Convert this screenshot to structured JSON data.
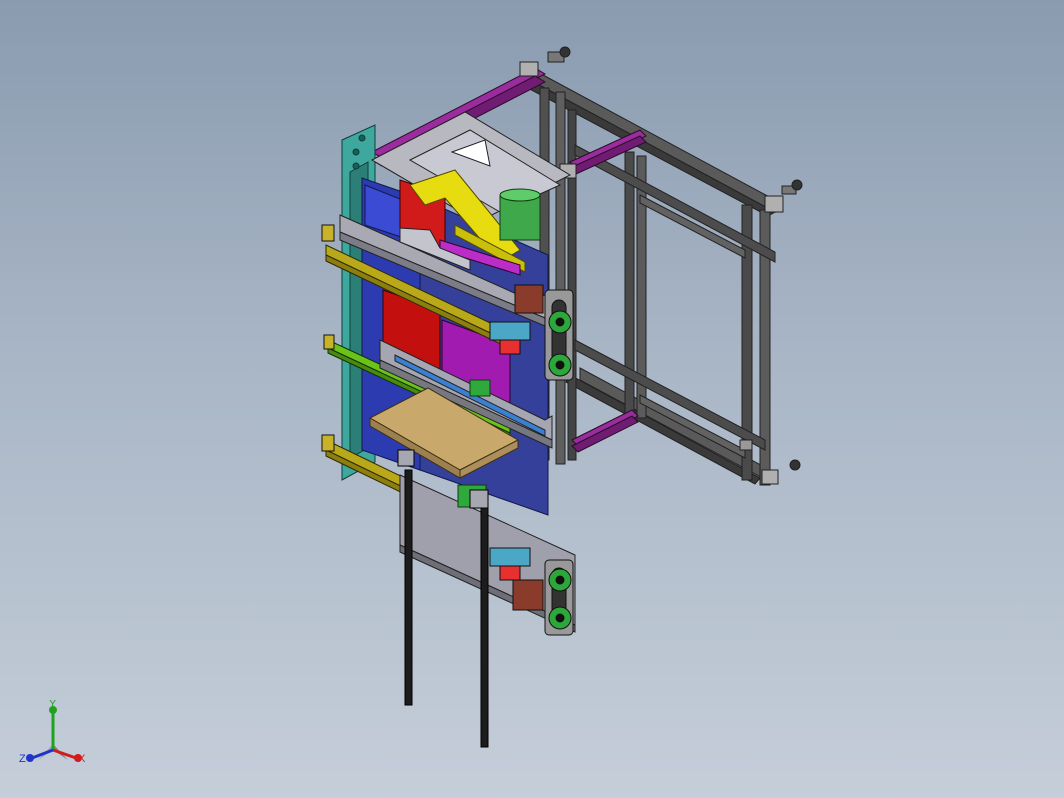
{
  "viewport": {
    "background_top": "#8a9bb0",
    "background_bottom": "#c5ced9"
  },
  "model": {
    "description_icon": "cad-assembly-machine"
  },
  "triad": {
    "x_label": "X",
    "y_label": "Y",
    "z_label": "Z",
    "x_color": "#d21c1c",
    "y_color": "#1fa31f",
    "z_color": "#2233cc"
  }
}
